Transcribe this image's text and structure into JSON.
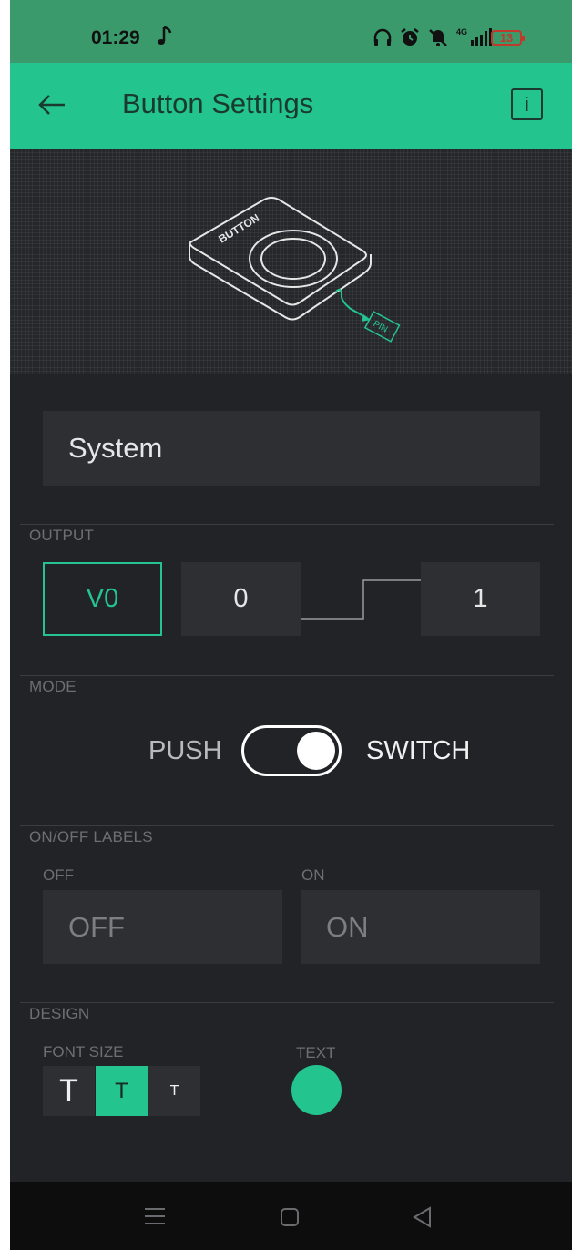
{
  "status_bar": {
    "time": "01:29",
    "network": "4G",
    "battery": "13",
    "icons": [
      "music-note-icon",
      "headphones-icon",
      "alarm-icon",
      "mute-icon",
      "signal-icon",
      "battery-icon"
    ]
  },
  "app_bar": {
    "title": "Button Settings",
    "back_icon": "arrow-left-icon",
    "info_label": "i"
  },
  "hero": {
    "button_text": "BUTTON",
    "pin_text": "PIN"
  },
  "name_field": {
    "value": "System"
  },
  "output": {
    "label": "OUTPUT",
    "pin": "V0",
    "low": "0",
    "high": "1"
  },
  "mode": {
    "label": "MODE",
    "left": "PUSH",
    "right": "SWITCH",
    "selected": "SWITCH"
  },
  "labels": {
    "label": "ON/OFF LABELS",
    "off_label": "OFF",
    "off_value": "OFF",
    "on_label": "ON",
    "on_value": "ON"
  },
  "design": {
    "label": "DESIGN",
    "font_size_label": "FONT SIZE",
    "font_sizes": [
      "T",
      "T",
      "T"
    ],
    "selected_font": 1,
    "text_color_label": "TEXT",
    "text_color": "#23c48e"
  },
  "colors": {
    "accent": "#23c48e",
    "background": "#222326",
    "field": "#2e2f33"
  }
}
